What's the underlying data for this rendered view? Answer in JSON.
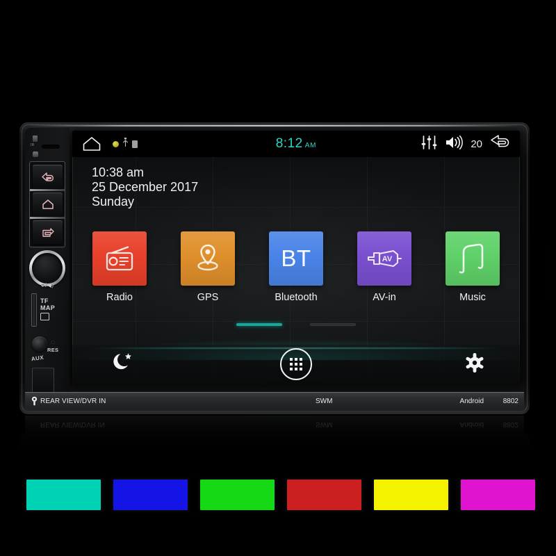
{
  "device": {
    "model": "8802",
    "brand_label": "Android",
    "swm_label": "SWM",
    "rear_label": "REAR VIEW/DVR IN",
    "left_panel": {
      "ir_label": "IR",
      "knob_label": "Ф/◀)",
      "tf_label": "TF\nMAP",
      "aux_label": "AUX",
      "res_label": "RES"
    }
  },
  "statusbar": {
    "home_icon": "home-icon",
    "status_icons": [
      "location-dot-icon",
      "usb-icon",
      "sdcard-icon"
    ],
    "clock": "8:12",
    "clock_meridiem": "AM",
    "equalizer_icon": "equalizer-icon",
    "volume_icon": "volume-icon",
    "volume_value": "20",
    "back_icon": "back-arrow-icon"
  },
  "clock_widget": {
    "time": "10:38 am",
    "date": "25 December 2017",
    "weekday": "Sunday"
  },
  "apps": [
    {
      "label": "Radio",
      "icon": "radio-icon",
      "color": "#e8402a",
      "glyph": "radio"
    },
    {
      "label": "GPS",
      "icon": "map-pin-icon",
      "color": "#df8f2b",
      "glyph": "pin"
    },
    {
      "label": "Bluetooth",
      "icon": "bt-text-icon",
      "color": "#4a84e8",
      "glyph": "bt",
      "text": "BT"
    },
    {
      "label": "AV-in",
      "icon": "av-plug-icon",
      "color": "#7a4fd0",
      "glyph": "plug"
    },
    {
      "label": "Music",
      "icon": "music-note-icon",
      "color": "#5fd169",
      "glyph": "note"
    }
  ],
  "pager": {
    "pages": 2,
    "active_index": 0,
    "active_color": "#17a699",
    "inactive_color": "#2b2f30"
  },
  "dock": [
    {
      "label": "",
      "icon": "moon-star-icon",
      "name": "night-mode-button"
    },
    {
      "label": "",
      "icon": "apps-grid-icon",
      "name": "all-apps-button"
    },
    {
      "label": "",
      "icon": "gear-icon",
      "name": "settings-button"
    }
  ],
  "swatches": [
    {
      "name": "cyan",
      "color": "#00d2b4"
    },
    {
      "name": "blue",
      "color": "#1414e6"
    },
    {
      "name": "green",
      "color": "#14d914"
    },
    {
      "name": "red",
      "color": "#cc1f1f"
    },
    {
      "name": "yellow",
      "color": "#f5f200"
    },
    {
      "name": "magenta",
      "color": "#e014cf"
    }
  ],
  "accent": {
    "teal": "#2fd6c6",
    "screen_bg": "#121415"
  }
}
